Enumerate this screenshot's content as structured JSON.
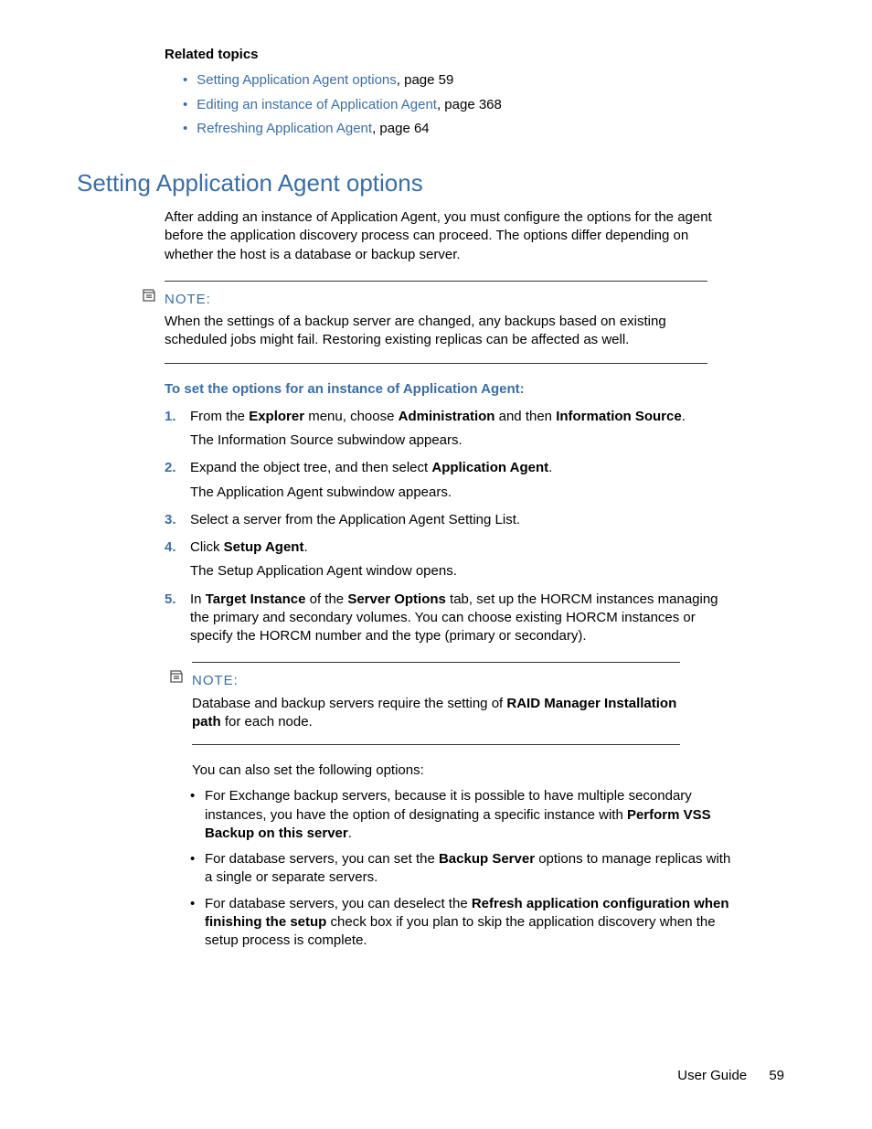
{
  "related": {
    "heading": "Related topics",
    "items": [
      {
        "link": "Setting Application Agent options",
        "suffix": ", page 59"
      },
      {
        "link": "Editing an instance of Application Agent",
        "suffix": ", page 368"
      },
      {
        "link": "Refreshing Application Agent",
        "suffix": ", page 64"
      }
    ]
  },
  "section": {
    "title": "Setting Application Agent options",
    "intro": "After adding an instance of Application Agent, you must configure the options for the agent before the application discovery process can proceed. The options differ depending on whether the host is a database or backup server."
  },
  "note1": {
    "label": "NOTE:",
    "text": "When the settings of a backup server are changed, any backups based on existing scheduled jobs might fail. Restoring existing replicas can be affected as well."
  },
  "subhead": "To set the options for an instance of Application Agent:",
  "steps": {
    "s1": {
      "num": "1.",
      "pre": "From the ",
      "b1": "Explorer",
      "mid1": " menu, choose ",
      "b2": "Administration",
      "mid2": " and then ",
      "b3": "Information Source",
      "post": ".",
      "sub": "The Information Source subwindow appears."
    },
    "s2": {
      "num": "2.",
      "pre": "Expand the object tree, and then select ",
      "b1": "Application Agent",
      "post": ".",
      "sub": "The Application Agent subwindow appears."
    },
    "s3": {
      "num": "3.",
      "text": "Select a server from the Application Agent Setting List."
    },
    "s4": {
      "num": "4.",
      "pre": "Click ",
      "b1": "Setup Agent",
      "post": ".",
      "sub": "The Setup Application Agent window opens."
    },
    "s5": {
      "num": "5.",
      "pre": "In ",
      "b1": "Target Instance",
      "mid1": " of the ",
      "b2": "Server Options",
      "post": " tab, set up the HORCM instances managing the primary and secondary volumes. You can choose existing HORCM instances or specify the HORCM number and the type (primary or secondary)."
    }
  },
  "note2": {
    "label": "NOTE:",
    "pre": "Database and backup servers require the setting of  ",
    "b1": "RAID Manager Installation path",
    "post": " for each node."
  },
  "also": "You can also set the following options:",
  "bullets": {
    "b1": {
      "pre": "For Exchange backup servers, because it is possible to have multiple secondary instances, you have the option of designating a specific instance with ",
      "bold": "Perform VSS Backup on this server",
      "post": "."
    },
    "b2": {
      "pre": "For database servers, you can set the ",
      "bold": "Backup Server",
      "post": " options to manage replicas with a single or separate servers."
    },
    "b3": {
      "pre": "For database servers, you can deselect the ",
      "bold": "Refresh application configuration when finishing the setup",
      "post": " check box if you plan to skip the application discovery when the setup process is complete."
    }
  },
  "footer": {
    "title": "User Guide",
    "page": "59"
  }
}
